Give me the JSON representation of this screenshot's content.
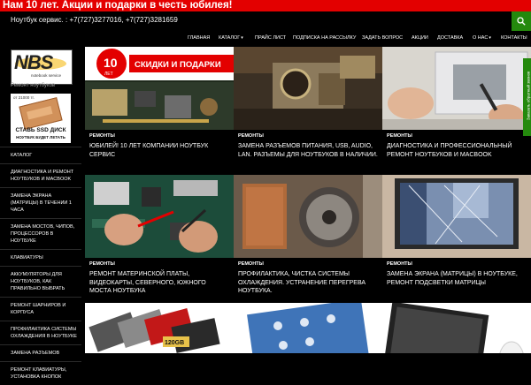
{
  "promo": {
    "text": "Нам 10 лет. Акции и подарки в честь юбилея!"
  },
  "header": {
    "contacts": "Ноутбук сервис. : +7(727)3277016, +7(727)3281659"
  },
  "search": {
    "icon": "search-icon"
  },
  "nav": {
    "items": [
      {
        "label": "Главная"
      },
      {
        "label": "Каталог",
        "has_caret": true
      },
      {
        "label": "Прайс лист"
      },
      {
        "label": "Подписка на рассылку"
      },
      {
        "label": "Задать вопрос"
      },
      {
        "label": "Акции"
      },
      {
        "label": "Доставка"
      },
      {
        "label": "О нас",
        "has_caret": true
      },
      {
        "label": "Контакты"
      }
    ]
  },
  "sidebar": {
    "logo": {
      "brand": "NBS",
      "sub": "notebook service"
    },
    "repair_link": "Ремонт ноутбуков",
    "ssd_ad": {
      "price": "от 21000 тг.",
      "line1": "СТАВЬ SSD ДИСК",
      "line2": "НОУТБУК БУДЕТ ЛЕТАТЬ"
    },
    "categories": [
      "Каталог",
      "Диагностика и ремонт ноутбуков и MacBook",
      "Замена экрана (матрицы) в течении 1 часа",
      "Замена мостов, чипов, процессоров в ноутбуке",
      "Клавиатуры",
      "Аккумуляторы для ноутбуков, как правильно выбрать",
      "Ремонт шарниров и корпуса",
      "Профилактика системы охлаждения в ноутбуке",
      "Замена разъемов",
      "Ремонт клавиатуры, установка кнопок"
    ]
  },
  "cards": [
    {
      "category": "Ремонты",
      "title": "Юбилей! 10 лет компании Ноутбук Сервис",
      "image": "anniversary-banner",
      "banner_number": "10",
      "banner_sub": "ЛЕТ",
      "banner_text": "СКИДКИ И ПОДАРКИ"
    },
    {
      "category": "Ремонты",
      "title": "Замена разъемов питания, USB, audio, LAN. Разъемы для ноутбуков в наличии.",
      "image": "power-jack-photo"
    },
    {
      "category": "Ремонты",
      "title": "Диагностика и профессиональный ремонт ноутбуков и MacBook",
      "image": "macbook-repair-photo"
    },
    {
      "category": "Ремонты",
      "title": "Ремонт материнской платы, видеокарты, северного, южного моста ноутбука",
      "image": "motherboard-repair-photo"
    },
    {
      "category": "Ремонты",
      "title": "Профилактика, чистка системы охлаждения. Устранение перегрева ноутбука.",
      "image": "cooling-fan-photo"
    },
    {
      "category": "Ремонты",
      "title": "Замена экрана (матрицы) в ноутбуке, ремонт подсветки матрицы",
      "image": "broken-screen-photo"
    },
    {
      "image": "ssd-drives-photo",
      "drive_label": "120GB"
    },
    {
      "image": "keyboard-membrane-photo"
    },
    {
      "image": "laptop-screen-photo"
    }
  ],
  "feedback": {
    "label": "Заказать обратный звонок"
  },
  "colors": {
    "accent_green": "#24890d",
    "promo_red": "#e30000"
  }
}
